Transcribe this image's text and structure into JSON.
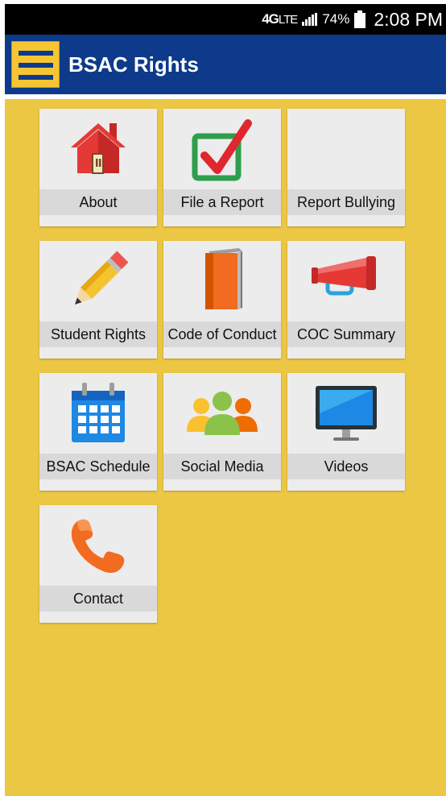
{
  "status_bar": {
    "network": "4G",
    "network_suffix": "LTE",
    "battery": "74%",
    "time": "2:08 PM"
  },
  "app_bar": {
    "title": "BSAC Rights",
    "menu_icon": "hamburger-menu-icon"
  },
  "tiles": [
    {
      "label": "About",
      "icon": "house-icon"
    },
    {
      "label": "File a Report",
      "icon": "checkbox-icon"
    },
    {
      "label": "Report Bullying",
      "icon": ""
    },
    {
      "label": "Student Rights",
      "icon": "pencil-icon"
    },
    {
      "label": "Code of Conduct",
      "icon": "book-icon"
    },
    {
      "label": "COC Summary",
      "icon": "megaphone-icon"
    },
    {
      "label": "BSAC Schedule",
      "icon": "calendar-icon"
    },
    {
      "label": "Social Media",
      "icon": "people-icon"
    },
    {
      "label": "Videos",
      "icon": "monitor-icon"
    },
    {
      "label": "Contact",
      "icon": "phone-icon"
    }
  ],
  "colors": {
    "app_bar": "#0d3a8a",
    "background": "#ecc743",
    "tile": "#ececec",
    "tile_label": "#d9d9d9"
  }
}
